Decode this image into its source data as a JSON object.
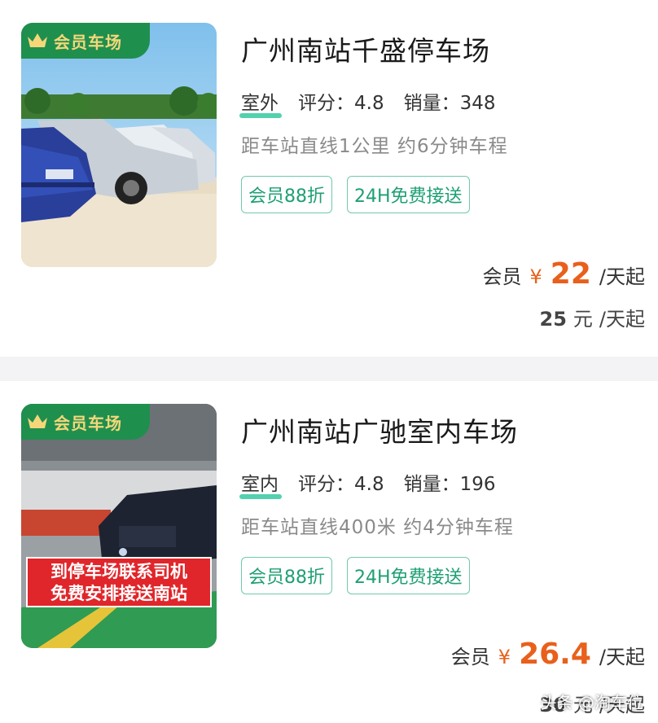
{
  "member_tag_label": "会员车场",
  "listings": [
    {
      "title": "广州南站千盛停车场",
      "type": "室外",
      "rating_label": "评分：",
      "rating": "4.8",
      "sales_label": "销量：",
      "sales": "348",
      "distance": "距车站直线1公里 约6分钟车程",
      "badges": [
        "会员88折",
        "24H免费接送"
      ],
      "member_label": "会员",
      "currency": "¥",
      "member_price": "22",
      "unit": "/天起",
      "regular_price": "25",
      "regular_unit": "元",
      "regular_suffix": "/天起"
    },
    {
      "title": "广州南站广驰室内车场",
      "type": "室内",
      "rating_label": "评分：",
      "rating": "4.8",
      "sales_label": "销量：",
      "sales": "196",
      "distance": "距车站直线400米 约4分钟车程",
      "banner_line1": "到停车场联系司机",
      "banner_line2": "免费安排接送南站",
      "badges": [
        "会员88折",
        "24H免费接送"
      ],
      "member_label": "会员",
      "currency": "¥",
      "member_price": "26.4",
      "unit": "/天起",
      "regular_price": "30",
      "regular_unit": "元",
      "regular_suffix": "/天起"
    }
  ],
  "watermark": "头条 @淘车位",
  "colors": {
    "member_tag_bg": "#1f8f4e",
    "member_tag_text": "#f5d77a",
    "price_accent": "#e8601c",
    "badge_text": "#1e9f73",
    "type_underline": "#35c9a0",
    "banner_red": "#e0262b"
  }
}
